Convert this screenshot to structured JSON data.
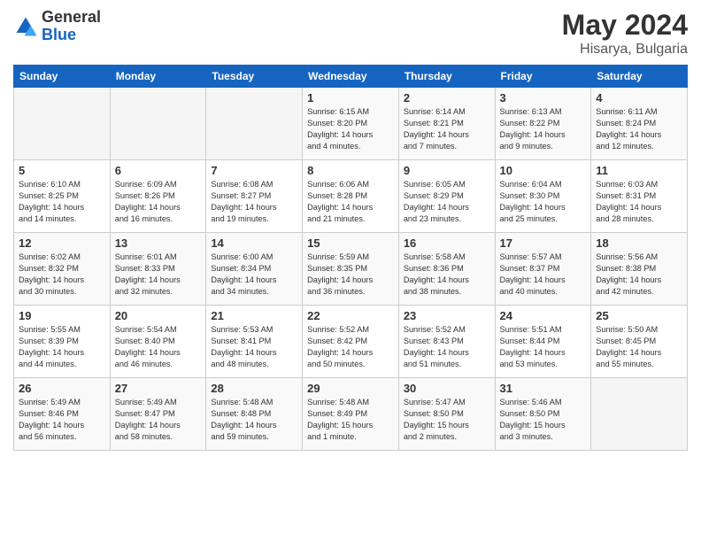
{
  "logo": {
    "general": "General",
    "blue": "Blue"
  },
  "title": {
    "month_year": "May 2024",
    "location": "Hisarya, Bulgaria"
  },
  "weekdays": [
    "Sunday",
    "Monday",
    "Tuesday",
    "Wednesday",
    "Thursday",
    "Friday",
    "Saturday"
  ],
  "weeks": [
    [
      {
        "day": "",
        "info": ""
      },
      {
        "day": "",
        "info": ""
      },
      {
        "day": "",
        "info": ""
      },
      {
        "day": "1",
        "info": "Sunrise: 6:15 AM\nSunset: 8:20 PM\nDaylight: 14 hours\nand 4 minutes."
      },
      {
        "day": "2",
        "info": "Sunrise: 6:14 AM\nSunset: 8:21 PM\nDaylight: 14 hours\nand 7 minutes."
      },
      {
        "day": "3",
        "info": "Sunrise: 6:13 AM\nSunset: 8:22 PM\nDaylight: 14 hours\nand 9 minutes."
      },
      {
        "day": "4",
        "info": "Sunrise: 6:11 AM\nSunset: 8:24 PM\nDaylight: 14 hours\nand 12 minutes."
      }
    ],
    [
      {
        "day": "5",
        "info": "Sunrise: 6:10 AM\nSunset: 8:25 PM\nDaylight: 14 hours\nand 14 minutes."
      },
      {
        "day": "6",
        "info": "Sunrise: 6:09 AM\nSunset: 8:26 PM\nDaylight: 14 hours\nand 16 minutes."
      },
      {
        "day": "7",
        "info": "Sunrise: 6:08 AM\nSunset: 8:27 PM\nDaylight: 14 hours\nand 19 minutes."
      },
      {
        "day": "8",
        "info": "Sunrise: 6:06 AM\nSunset: 8:28 PM\nDaylight: 14 hours\nand 21 minutes."
      },
      {
        "day": "9",
        "info": "Sunrise: 6:05 AM\nSunset: 8:29 PM\nDaylight: 14 hours\nand 23 minutes."
      },
      {
        "day": "10",
        "info": "Sunrise: 6:04 AM\nSunset: 8:30 PM\nDaylight: 14 hours\nand 25 minutes."
      },
      {
        "day": "11",
        "info": "Sunrise: 6:03 AM\nSunset: 8:31 PM\nDaylight: 14 hours\nand 28 minutes."
      }
    ],
    [
      {
        "day": "12",
        "info": "Sunrise: 6:02 AM\nSunset: 8:32 PM\nDaylight: 14 hours\nand 30 minutes."
      },
      {
        "day": "13",
        "info": "Sunrise: 6:01 AM\nSunset: 8:33 PM\nDaylight: 14 hours\nand 32 minutes."
      },
      {
        "day": "14",
        "info": "Sunrise: 6:00 AM\nSunset: 8:34 PM\nDaylight: 14 hours\nand 34 minutes."
      },
      {
        "day": "15",
        "info": "Sunrise: 5:59 AM\nSunset: 8:35 PM\nDaylight: 14 hours\nand 36 minutes."
      },
      {
        "day": "16",
        "info": "Sunrise: 5:58 AM\nSunset: 8:36 PM\nDaylight: 14 hours\nand 38 minutes."
      },
      {
        "day": "17",
        "info": "Sunrise: 5:57 AM\nSunset: 8:37 PM\nDaylight: 14 hours\nand 40 minutes."
      },
      {
        "day": "18",
        "info": "Sunrise: 5:56 AM\nSunset: 8:38 PM\nDaylight: 14 hours\nand 42 minutes."
      }
    ],
    [
      {
        "day": "19",
        "info": "Sunrise: 5:55 AM\nSunset: 8:39 PM\nDaylight: 14 hours\nand 44 minutes."
      },
      {
        "day": "20",
        "info": "Sunrise: 5:54 AM\nSunset: 8:40 PM\nDaylight: 14 hours\nand 46 minutes."
      },
      {
        "day": "21",
        "info": "Sunrise: 5:53 AM\nSunset: 8:41 PM\nDaylight: 14 hours\nand 48 minutes."
      },
      {
        "day": "22",
        "info": "Sunrise: 5:52 AM\nSunset: 8:42 PM\nDaylight: 14 hours\nand 50 minutes."
      },
      {
        "day": "23",
        "info": "Sunrise: 5:52 AM\nSunset: 8:43 PM\nDaylight: 14 hours\nand 51 minutes."
      },
      {
        "day": "24",
        "info": "Sunrise: 5:51 AM\nSunset: 8:44 PM\nDaylight: 14 hours\nand 53 minutes."
      },
      {
        "day": "25",
        "info": "Sunrise: 5:50 AM\nSunset: 8:45 PM\nDaylight: 14 hours\nand 55 minutes."
      }
    ],
    [
      {
        "day": "26",
        "info": "Sunrise: 5:49 AM\nSunset: 8:46 PM\nDaylight: 14 hours\nand 56 minutes."
      },
      {
        "day": "27",
        "info": "Sunrise: 5:49 AM\nSunset: 8:47 PM\nDaylight: 14 hours\nand 58 minutes."
      },
      {
        "day": "28",
        "info": "Sunrise: 5:48 AM\nSunset: 8:48 PM\nDaylight: 14 hours\nand 59 minutes."
      },
      {
        "day": "29",
        "info": "Sunrise: 5:48 AM\nSunset: 8:49 PM\nDaylight: 15 hours\nand 1 minute."
      },
      {
        "day": "30",
        "info": "Sunrise: 5:47 AM\nSunset: 8:50 PM\nDaylight: 15 hours\nand 2 minutes."
      },
      {
        "day": "31",
        "info": "Sunrise: 5:46 AM\nSunset: 8:50 PM\nDaylight: 15 hours\nand 3 minutes."
      },
      {
        "day": "",
        "info": ""
      }
    ]
  ]
}
